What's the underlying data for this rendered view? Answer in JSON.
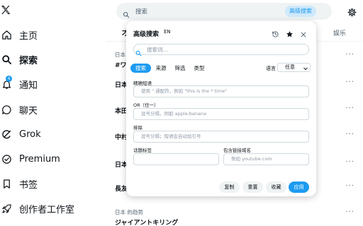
{
  "sidebar": {
    "logo": "x-logo-icon",
    "items": [
      {
        "label": "主页",
        "icon": "home-icon"
      },
      {
        "label": "探索",
        "icon": "search-icon"
      },
      {
        "label": "通知",
        "icon": "bell-icon",
        "badge": "4"
      },
      {
        "label": "聊天",
        "icon": "chat-bubble-icon"
      },
      {
        "label": "Grok",
        "icon": "grok-icon"
      },
      {
        "label": "Premium",
        "icon": "verified-icon"
      },
      {
        "label": "书签",
        "icon": "bookmark-icon"
      },
      {
        "label": "创作者工作室",
        "icon": "rocket-icon"
      }
    ]
  },
  "search": {
    "placeholder": "搜索",
    "advanced_label": "高级搜索"
  },
  "tabs": {
    "left": "才",
    "right": "娱乐"
  },
  "trends": [
    {
      "meta": "日本",
      "title": "#ワ"
    },
    {
      "meta": "",
      "title": "日本"
    },
    {
      "meta": "",
      "title": "本田"
    },
    {
      "meta": "",
      "title": "中村"
    },
    {
      "meta": "",
      "title": "日本"
    },
    {
      "meta": "",
      "title": "長友"
    },
    {
      "meta": "日本 的趋势",
      "title": "ジャイアントキリング"
    }
  ],
  "modal": {
    "title": "高级搜索",
    "lang_code": "EN",
    "search_placeholder": "搜索词...",
    "pills": [
      "搜索",
      "来源",
      "筛选",
      "类型"
    ],
    "language_label": "语言",
    "language_value": "任意",
    "fields": {
      "exact_label": "精确短语",
      "exact_placeholder": "使用 \" 通配符，例如 \"this is the * time\"",
      "or_label": "OR（任一）",
      "or_placeholder": "逗号分隔，例如 apple,banana",
      "exclude_label": "排除",
      "exclude_placeholder": "逗号分隔；短语会自动加引号",
      "hashtag_label": "话题标签",
      "hashtag_placeholder": "",
      "link_label": "包含链接域名",
      "link_placeholder": "例如 youtube.com"
    },
    "buttons": {
      "copy": "复制",
      "reset": "重置",
      "save": "收藏",
      "apply": "应用"
    }
  },
  "colors": {
    "accent": "#1d9bf0",
    "text": "#0f1419",
    "muted": "#536471",
    "border": "#cfd9de"
  }
}
